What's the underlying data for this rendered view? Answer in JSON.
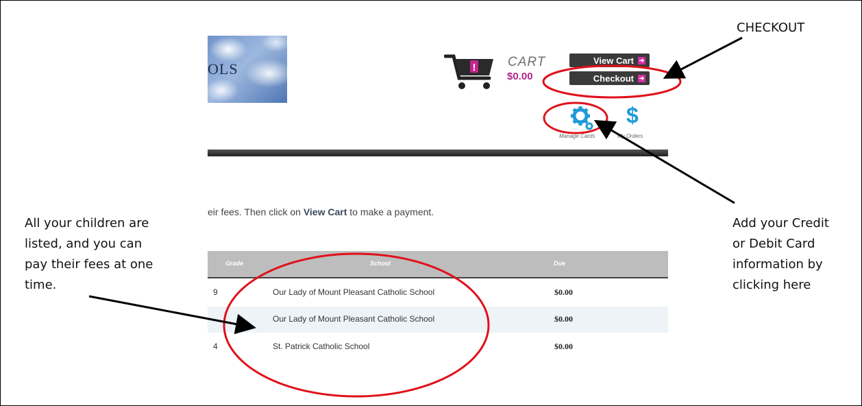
{
  "header": {
    "logo_text": "OLS",
    "cart_label": "CART",
    "cart_total": "$0.00",
    "view_cart_label": "View Cart",
    "checkout_label": "Checkout",
    "manage_cards_label": "Manage Cards",
    "orders_label": "My Orders",
    "dollar_glyph": "$"
  },
  "main": {
    "instruction_prefix": "eir fees. Then click on ",
    "instruction_link": "View Cart",
    "instruction_suffix": " to make a payment.",
    "columns": [
      "Grade",
      "School",
      "Due"
    ],
    "rows": [
      {
        "grade": "9",
        "school": "Our Lady of Mount Pleasant Catholic School",
        "due": "$0.00"
      },
      {
        "grade": "",
        "school": "Our Lady of Mount Pleasant Catholic School",
        "due": "$0.00"
      },
      {
        "grade": "4",
        "school": "St. Patrick Catholic School",
        "due": "$0.00"
      }
    ]
  },
  "annotations": {
    "checkout_note": "CHECKOUT",
    "children_note_1": "All your children are",
    "children_note_2": "listed, and you can",
    "children_note_3": "pay their fees at one",
    "children_note_4": "time.",
    "card_note_1": "Add your Credit",
    "card_note_2": "or Debit Card",
    "card_note_3": "information  by",
    "card_note_4": "clicking here"
  },
  "colors": {
    "accent": "#b0268b",
    "button_bg": "#3a3a3a",
    "gear_blue": "#1f9ad6",
    "highlight_red": "#e0101a"
  }
}
